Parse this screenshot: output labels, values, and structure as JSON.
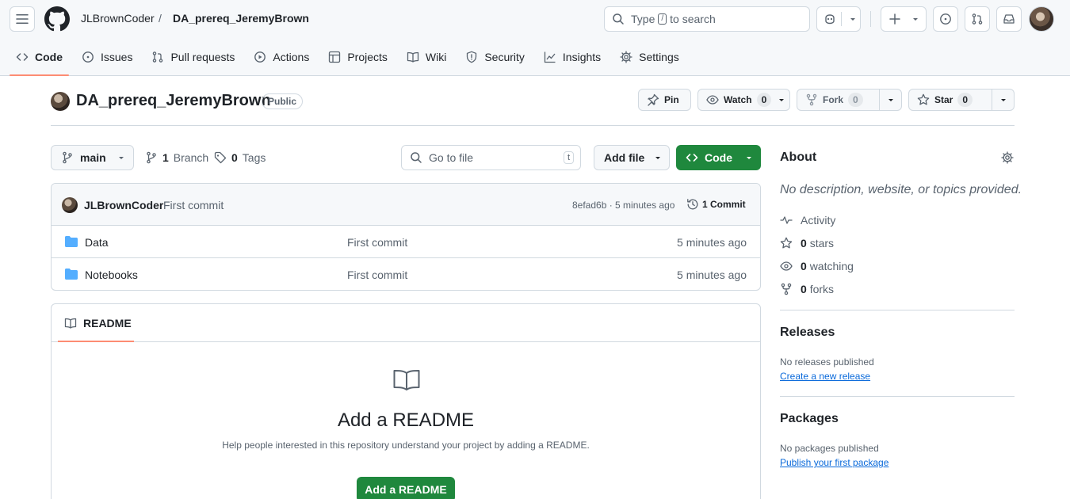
{
  "header": {
    "owner": "JLBrownCoder",
    "separator": "/",
    "repo": "DA_prereq_JeremyBrown",
    "search_prefix": "Type",
    "search_key": "/",
    "search_suffix": "to search"
  },
  "tabs": [
    {
      "label": "Code",
      "icon": "code-icon",
      "active": true
    },
    {
      "label": "Issues",
      "icon": "issue-icon"
    },
    {
      "label": "Pull requests",
      "icon": "pull-request-icon"
    },
    {
      "label": "Actions",
      "icon": "play-icon"
    },
    {
      "label": "Projects",
      "icon": "table-icon"
    },
    {
      "label": "Wiki",
      "icon": "book-icon"
    },
    {
      "label": "Security",
      "icon": "shield-icon"
    },
    {
      "label": "Insights",
      "icon": "graph-icon"
    },
    {
      "label": "Settings",
      "icon": "gear-icon"
    }
  ],
  "repo_header": {
    "title": "DA_prereq_JeremyBrown",
    "visibility": "Public",
    "pin_label": "Pin",
    "watch_label": "Watch",
    "watch_count": "0",
    "fork_label": "Fork",
    "fork_count": "0",
    "star_label": "Star",
    "star_count": "0"
  },
  "controls": {
    "branch": "main",
    "branch_count": "1",
    "branch_label": "Branch",
    "tag_count": "0",
    "tag_label": "Tags",
    "goto_placeholder": "Go to file",
    "goto_key": "t",
    "add_file": "Add file",
    "code_button": "Code"
  },
  "latest_commit": {
    "author": "JLBrownCoder",
    "message": "First commit",
    "sha_time": "8efad6b · 5 minutes ago",
    "commit_count": "1 Commit"
  },
  "files": [
    {
      "name": "Data",
      "message": "First commit",
      "time": "5 minutes ago"
    },
    {
      "name": "Notebooks",
      "message": "First commit",
      "time": "5 minutes ago"
    }
  ],
  "readme": {
    "tab": "README",
    "heading": "Add a README",
    "description": "Help people interested in this repository understand your project by adding a README.",
    "button": "Add a README"
  },
  "about": {
    "heading": "About",
    "description": "No description, website, or topics provided.",
    "activity": "Activity",
    "stars_count": "0",
    "stars_label": "stars",
    "watching_count": "0",
    "watching_label": "watching",
    "forks_count": "0",
    "forks_label": "forks"
  },
  "releases": {
    "heading": "Releases",
    "status": "No releases published",
    "link": "Create a new release"
  },
  "packages": {
    "heading": "Packages",
    "status": "No packages published",
    "link": "Publish your first package"
  },
  "colors": {
    "accent_green": "#1f883d",
    "tab_underline": "#fd8c73",
    "link_blue": "#0969da",
    "folder_blue": "#54aeff"
  }
}
